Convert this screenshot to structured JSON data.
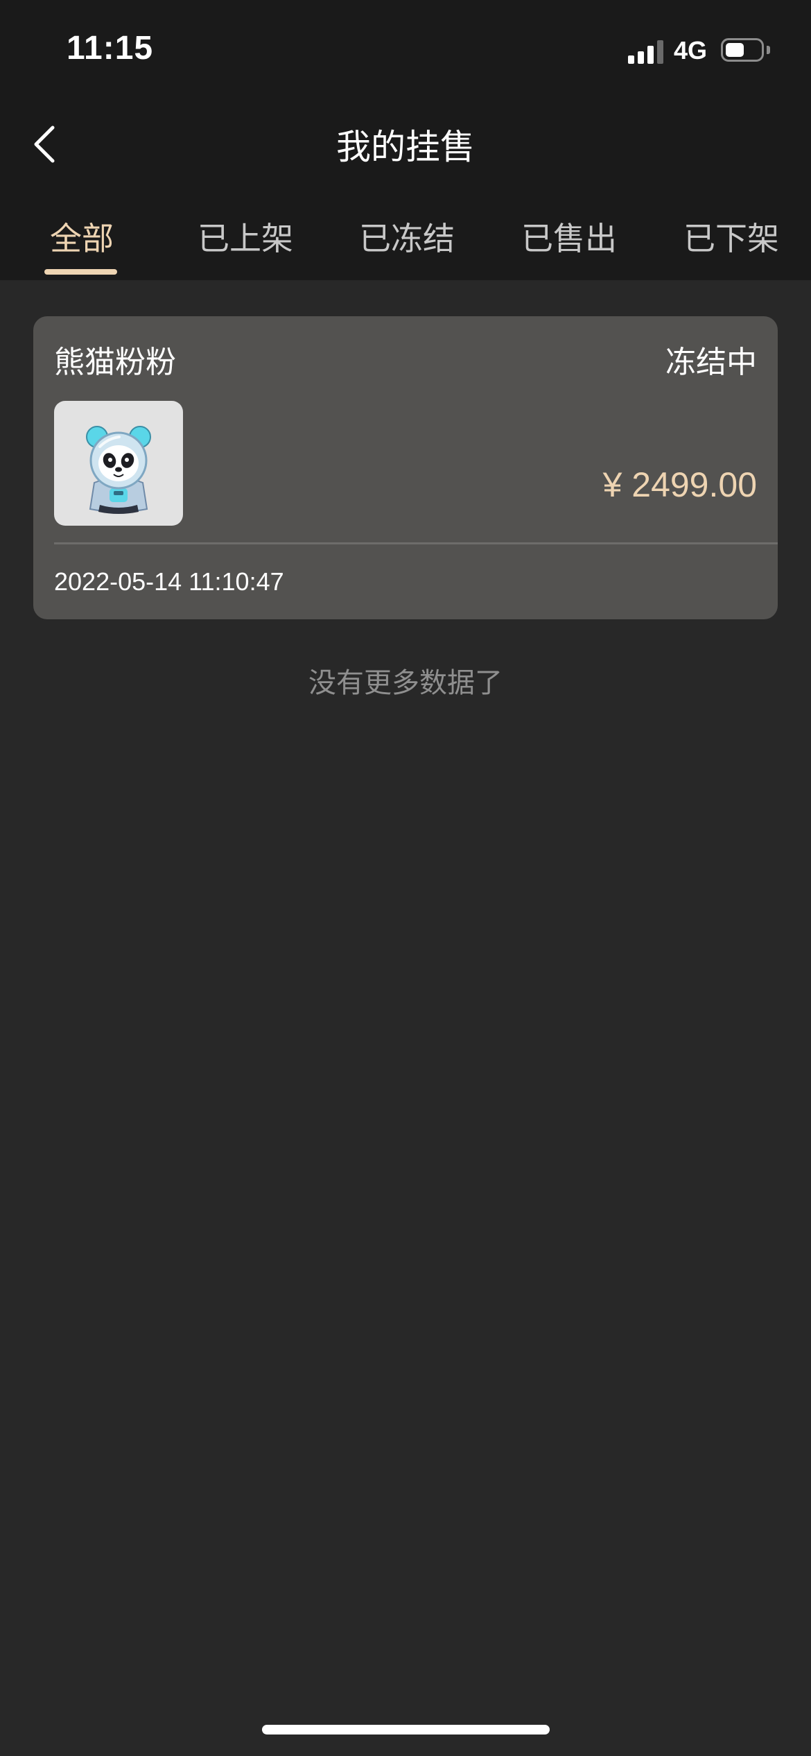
{
  "status_bar": {
    "time": "11:15",
    "network": "4G",
    "battery_level": 0.55,
    "signal_bars": 3
  },
  "nav": {
    "title": "我的挂售",
    "back_icon": "chevron-left-icon"
  },
  "tabs": [
    {
      "label": "全部",
      "active": true
    },
    {
      "label": "已上架",
      "active": false
    },
    {
      "label": "已冻结",
      "active": false
    },
    {
      "label": "已售出",
      "active": false
    },
    {
      "label": "已下架",
      "active": false
    }
  ],
  "listings": [
    {
      "name": "熊猫粉粉",
      "status": "冻结中",
      "price": "¥ 2499.00",
      "date": "2022-05-14 11:10:47",
      "thumbnail_icon": "panda-astronaut-icon"
    }
  ],
  "footer": {
    "no_more_text": "没有更多数据了"
  },
  "colors": {
    "accent": "#eed4b2",
    "page_background": "#282828",
    "header_background": "#1a1a1a",
    "card_background": "#535250"
  }
}
